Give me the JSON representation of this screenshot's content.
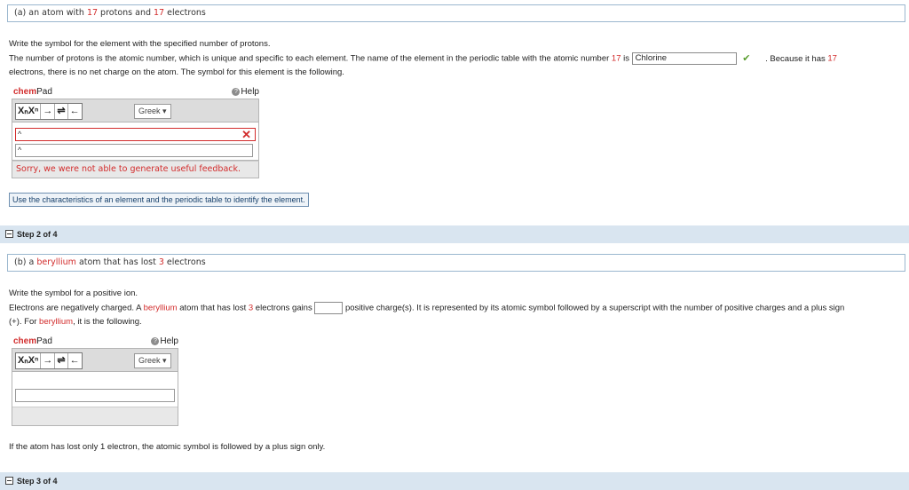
{
  "step1": {
    "question": {
      "pre": "(a) an atom with ",
      "n1": "17",
      "mid": " protons and ",
      "n2": "17",
      "post": " electrons"
    },
    "line1": "Write the symbol for the element with the specified number of protons.",
    "line2_pre": "The number of protons is the atomic number, which is unique and specific to each element. The name of the element in the periodic table with the atomic number ",
    "line2_num": "17",
    "line2_is": " is ",
    "answer_value": "Chlorine",
    "line2_after": ". Because it has ",
    "line2_num2": "17",
    "line3": "electrons, there is no net charge on the atom. The symbol for this element is the following.",
    "chempad": {
      "title_chem": "chem",
      "title_pad": "Pad",
      "help": "Help",
      "greek": "Greek ▾",
      "editor1": "^",
      "editor2": "^",
      "feedback": "Sorry, we were not able to generate useful feedback."
    },
    "hint": "Use the characteristics of an element and the periodic table to identify the element."
  },
  "step2": {
    "header": "Step 2 of 4",
    "question": {
      "pre": "(b) a ",
      "element": "beryllium",
      "mid": " atom that has lost ",
      "n": "3",
      "post": " electrons"
    },
    "line1": "Write the symbol for a positive ion.",
    "line2_pre": "Electrons are negatively charged. A ",
    "line2_element": "beryllium",
    "line2_mid": " atom that has lost ",
    "line2_num": "3",
    "line2_gains": " electrons gains ",
    "line2_after": " positive charge(s). It is represented by its atomic symbol followed by a superscript with the number of positive charges and a plus sign",
    "line3_pre": "(+). For ",
    "line3_element": "beryllium",
    "line3_post": ", it is the following.",
    "chempad": {
      "title_chem": "chem",
      "title_pad": "Pad",
      "help": "Help",
      "greek": "Greek ▾"
    },
    "note": "If the atom has lost only 1 electron, the atomic symbol is followed by a plus sign only."
  },
  "step3": {
    "header": "Step 3 of 4"
  },
  "toolbar": {
    "sub_sup": "XₙXⁿ",
    "arrow": "→",
    "equilibrium": "⇌",
    "back": "←"
  },
  "colors": {
    "accent_red": "#d22c2c",
    "step_bar": "#d9e5f0",
    "check_green": "#5a9e2f"
  }
}
